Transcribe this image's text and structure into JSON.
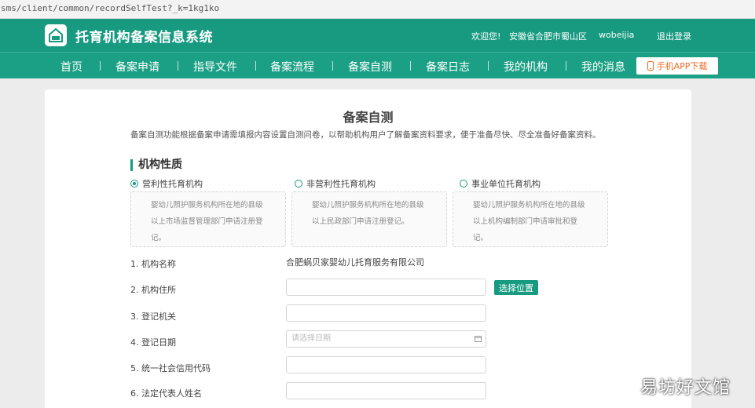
{
  "url": "sms/client/common/recordSelfTest?_k=1kg1ko",
  "header": {
    "site_title": "托育机构备案信息系统",
    "welcome": "欢迎您!",
    "region": "安徽省合肥市蜀山区",
    "username": "wobeijia",
    "logout": "退出登录"
  },
  "nav": {
    "items": [
      "首页",
      "备案申请",
      "指导文件",
      "备案流程",
      "备案自测",
      "备案日志",
      "我的机构",
      "我的消息"
    ],
    "app_download": "手机APP下载"
  },
  "page": {
    "title": "备案自测",
    "description": "备案自测功能根据备案申请需填报内容设置自测问卷，以帮助机构用户了解备案资料要求，便于准备尽快、尽全准备好备案资料。",
    "section_title": "机构性质",
    "options": [
      {
        "label": "营利性托育机构",
        "selected": true,
        "desc_lines": [
          "婴幼儿照护服务机构所在地的县级",
          "以上市场监督管理部门申请注册登",
          "记。"
        ]
      },
      {
        "label": "非营利性托育机构",
        "selected": false,
        "desc_lines": [
          "婴幼儿照护服务机构所在地的县级",
          "以上民政部门申请注册登记。"
        ]
      },
      {
        "label": "事业单位托育机构",
        "selected": false,
        "desc_lines": [
          "婴幼儿照护服务机构所在地的县级",
          "以上机构编制部门申请审批和登",
          "记。"
        ]
      }
    ],
    "fields": [
      {
        "label": "1. 机构名称",
        "value": "合肥蜗贝家婴幼儿托育服务有限公司"
      },
      {
        "label": "2. 机构住所",
        "value": ""
      },
      {
        "label": "3. 登记机关",
        "value": ""
      },
      {
        "label": "4. 登记日期",
        "placeholder": "请选择日期"
      },
      {
        "label": "5. 统一社会信用代码",
        "value": ""
      },
      {
        "label": "6. 法定代表人姓名",
        "value": ""
      }
    ],
    "select_location_button": "选择位置"
  },
  "watermark": "易坊好文馆",
  "colors": {
    "primary": "#179a80",
    "app_button_text": "#f26a21"
  }
}
